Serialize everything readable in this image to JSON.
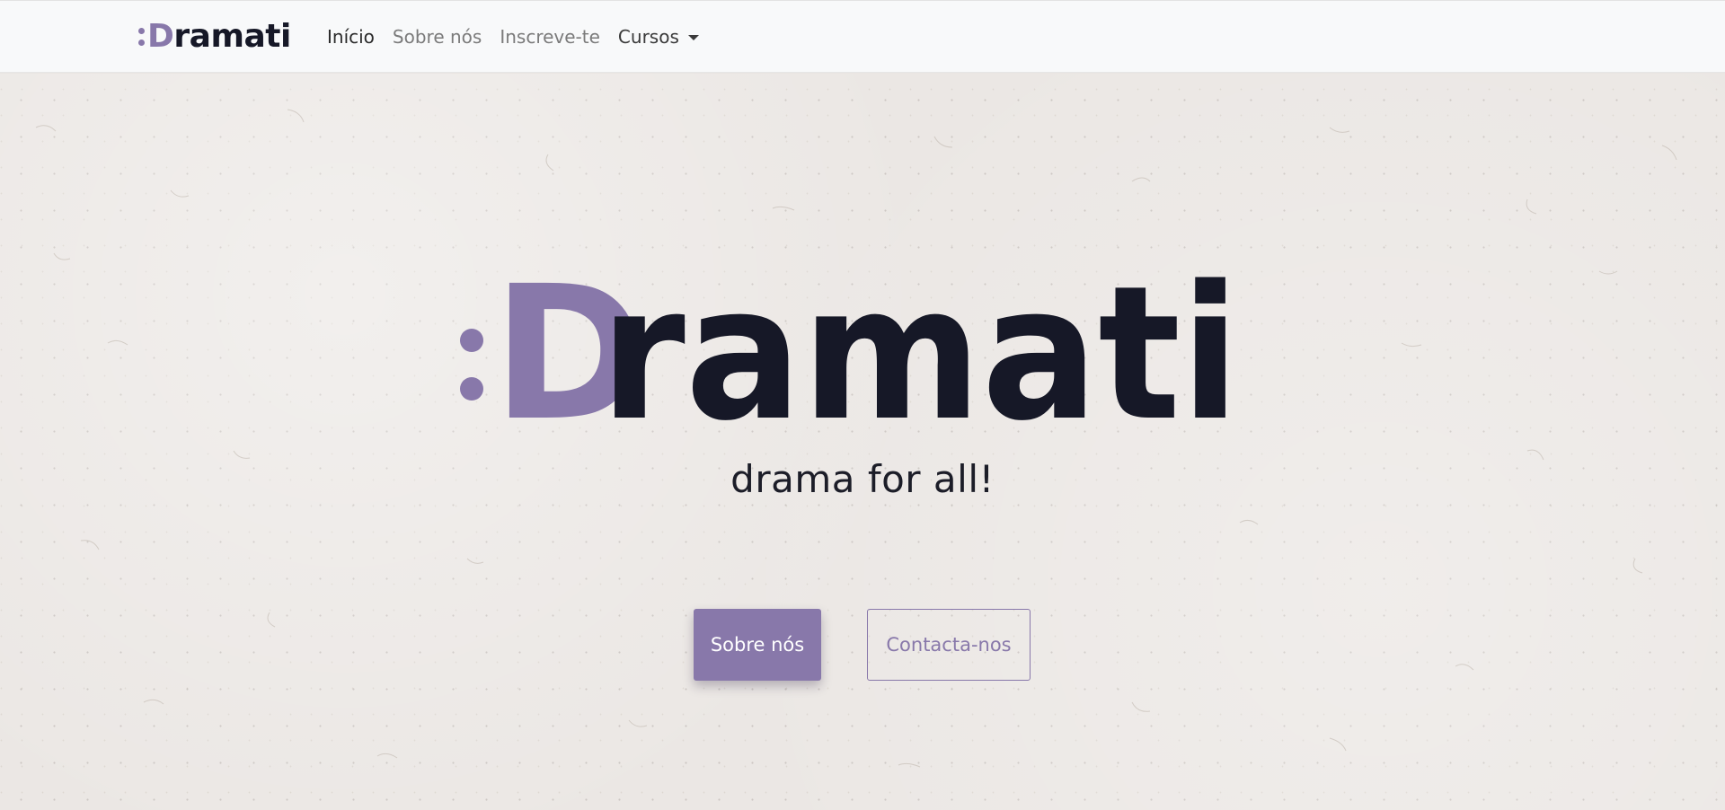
{
  "colors": {
    "brand_purple": "#8878aa",
    "brand_dark": "#161827",
    "navbar_bg": "#f8f9fa",
    "page_bg": "#ebe7e4"
  },
  "navbar": {
    "brand": {
      "colon_icon": "colon-dots-icon",
      "first_letter": "D",
      "rest": "ramati"
    },
    "links": [
      {
        "label": "Início",
        "active": true
      },
      {
        "label": "Sobre nós",
        "active": false
      },
      {
        "label": "Inscreve-te",
        "active": false
      },
      {
        "label": "Cursos",
        "active": false,
        "dropdown": true,
        "icon": "caret-down-icon"
      }
    ]
  },
  "hero": {
    "logo": {
      "first_letter": "D",
      "rest": "ramati"
    },
    "tagline": "drama for all!",
    "primary_button": "Sobre nós",
    "secondary_button": "Contacta-nos"
  }
}
